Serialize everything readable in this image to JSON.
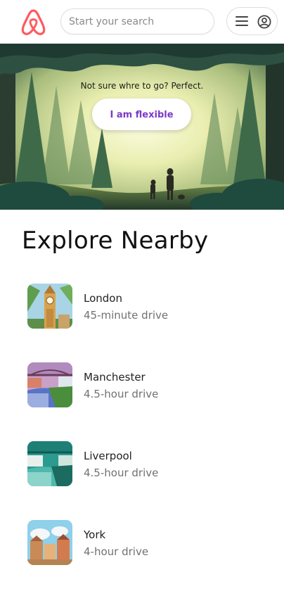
{
  "header": {
    "logo_icon": "airbnb-logo-icon",
    "search_placeholder": "Start your search",
    "menu_icon": "hamburger-menu-icon",
    "user_icon": "user-circle-icon",
    "brand_color": "#ff5a5f"
  },
  "hero": {
    "tagline": "Not sure whre to go? Perfect.",
    "button_label": "I am flexible",
    "button_color": "#7b39c8"
  },
  "explore": {
    "title": "Explore Nearby",
    "items": [
      {
        "city": "London",
        "distance": "45-minute drive"
      },
      {
        "city": "Manchester",
        "distance": "4.5-hour drive"
      },
      {
        "city": "Liverpool",
        "distance": "4.5-hour drive"
      },
      {
        "city": "York",
        "distance": "4-hour drive"
      }
    ]
  }
}
